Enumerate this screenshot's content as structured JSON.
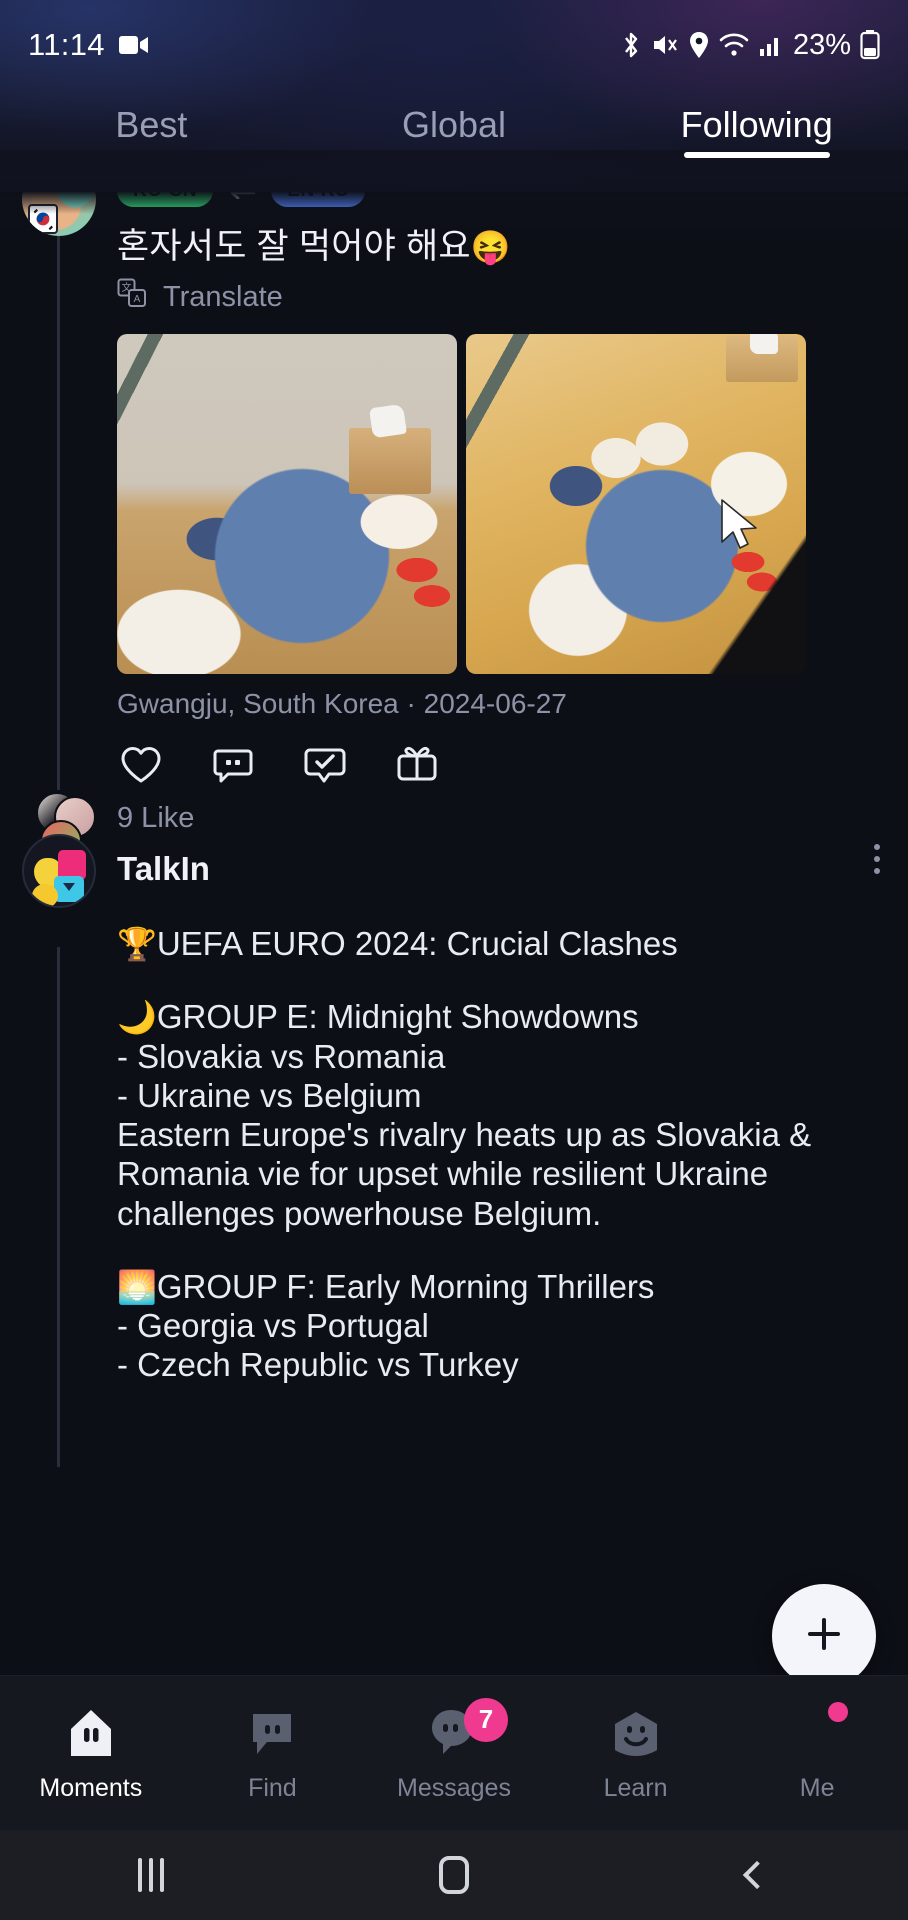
{
  "status_bar": {
    "time": "11:14",
    "battery_percent": "23%",
    "icons": [
      "video-recording-icon",
      "bluetooth-icon",
      "mute-icon",
      "location-icon",
      "wifi-icon",
      "signal-icon",
      "battery-icon"
    ]
  },
  "tabs": [
    {
      "label": "Best",
      "active": false
    },
    {
      "label": "Global",
      "active": false
    },
    {
      "label": "Following",
      "active": true
    }
  ],
  "posts": [
    {
      "id": "korean-meal-post",
      "language_pair": {
        "source": "KO CN",
        "target": "EN RU",
        "swap_icon": "swap-horizontal-icon"
      },
      "text": "혼자서도 잘 먹어야 해요",
      "text_emoji": "😝",
      "translate_label": "Translate",
      "photos": [
        {
          "alt": "Korean meal set on wooden table with blue bowl"
        },
        {
          "alt": "Top-down Korean meal tray with side dishes"
        }
      ],
      "location": "Gwangju, South Korea",
      "date": "2024-06-27",
      "meta_separator": " · ",
      "actions": [
        "like-heart-icon",
        "comment-icon",
        "check-bubble-icon",
        "gift-icon"
      ],
      "likes_text": "9 Like"
    },
    {
      "id": "talkin-post",
      "author": "TalkIn",
      "menu_icon": "more-options-icon",
      "body": {
        "title_emoji": "🏆",
        "title": "UEFA EURO 2024: Crucial Clashes",
        "group_e_emoji": "🌙",
        "group_e_title": "GROUP E: Midnight Showdowns",
        "group_e_match_1": "- Slovakia vs Romania",
        "group_e_match_2": "- Ukraine vs Belgium",
        "group_e_desc": "Eastern Europe's rivalry heats up as Slovakia & Romania vie for upset while resilient Ukraine challenges powerhouse Belgium.",
        "group_f_emoji": "🌅",
        "group_f_title": "GROUP F: Early Morning Thrillers",
        "group_f_match_1": "- Georgia vs Portugal",
        "group_f_match_2": "- Czech Republic vs Turkey"
      }
    }
  ],
  "fab": {
    "label": "+",
    "icon": "plus-icon"
  },
  "bottom_nav": [
    {
      "label": "Moments",
      "icon": "home-icon",
      "active": true,
      "badge": null
    },
    {
      "label": "Find",
      "icon": "discover-icon",
      "active": false,
      "badge": null
    },
    {
      "label": "Messages",
      "icon": "messages-icon",
      "active": false,
      "badge": "7"
    },
    {
      "label": "Learn",
      "icon": "learn-icon",
      "active": false,
      "badge": null
    },
    {
      "label": "Me",
      "icon": "profile-avatar",
      "active": false,
      "badge": null
    }
  ],
  "android_nav": {
    "recents_label": "recents-icon",
    "home_label": "home-button-icon",
    "back_label": "back-button-icon"
  },
  "colors": {
    "accent_pink": "#f03a8f",
    "lang_source": "#32d37a",
    "lang_target": "#4f7df0",
    "background": "#0d0f17",
    "text_primary": "#f0f2f7",
    "text_muted": "#8d92a6"
  }
}
